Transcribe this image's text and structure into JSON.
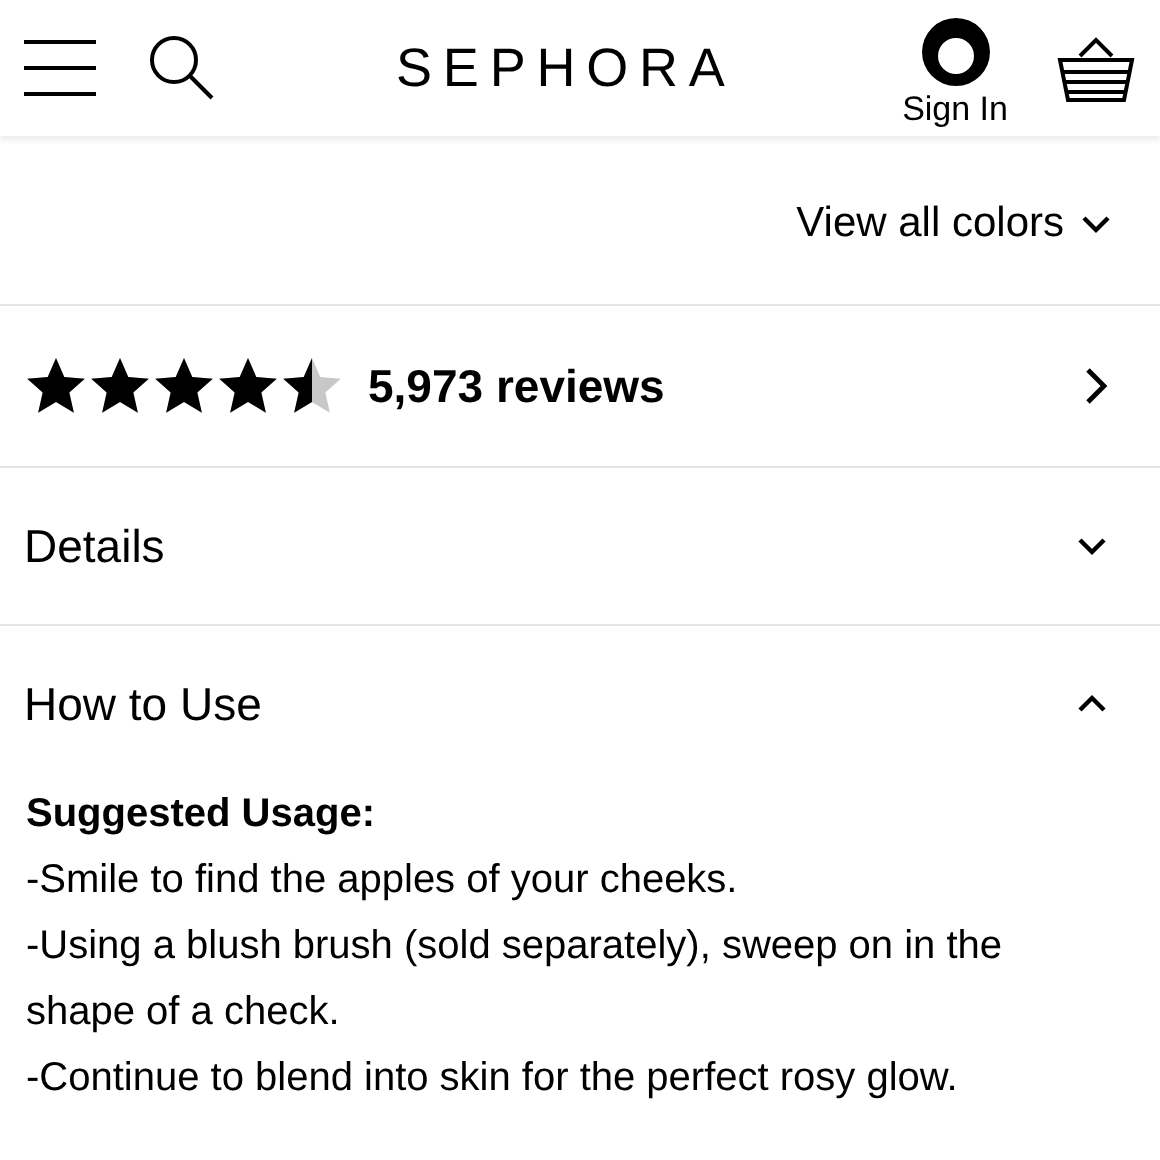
{
  "header": {
    "logo": "SEPHORA",
    "sign_in": "Sign In"
  },
  "view_all_colors": "View all colors",
  "reviews": {
    "stars": 4.5,
    "count": "5,973 reviews"
  },
  "sections": [
    {
      "title": "Details",
      "expanded": false
    },
    {
      "title": "How to Use",
      "expanded": true,
      "heading": "Suggested Usage:",
      "content": [
        "-Smile to find the apples of your cheeks.",
        "-Using a blush brush (sold separately), sweep on in the shape of a check.",
        "-Continue to blend into skin for the perfect rosy glow."
      ]
    }
  ]
}
